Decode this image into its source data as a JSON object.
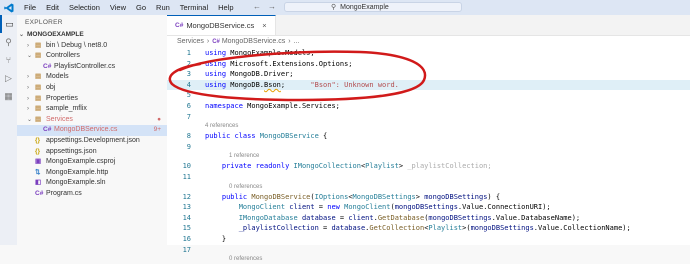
{
  "menubar": {
    "items": [
      "File",
      "Edit",
      "Selection",
      "View",
      "Go",
      "Run",
      "Terminal",
      "Help"
    ],
    "search_text": "MongoExample"
  },
  "sidebar": {
    "title": "EXPLORER",
    "project": "MONGOEXAMPLE",
    "rows": [
      {
        "label": "bin \\ Debug \\ net8.0",
        "indent": 1,
        "chevron": "›",
        "icon": "folder"
      },
      {
        "label": "Controllers",
        "indent": 1,
        "chevron": "⌄",
        "icon": "folder"
      },
      {
        "label": "PlaylistController.cs",
        "indent": 2,
        "chevron": "",
        "icon": "C#"
      },
      {
        "label": "Models",
        "indent": 1,
        "chevron": "›",
        "icon": "folder"
      },
      {
        "label": "obj",
        "indent": 1,
        "chevron": "›",
        "icon": "folder"
      },
      {
        "label": "Properties",
        "indent": 1,
        "chevron": "›",
        "icon": "folder"
      },
      {
        "label": "sample_mflix",
        "indent": 1,
        "chevron": "›",
        "icon": "folder"
      },
      {
        "label": "Services",
        "indent": 1,
        "chevron": "⌄",
        "icon": "folder",
        "badge": "●",
        "error": true
      },
      {
        "label": "MongoDBService.cs",
        "indent": 2,
        "chevron": "",
        "icon": "C#",
        "badge": "9+",
        "error": true,
        "selected": true
      },
      {
        "label": "appsettings.Development.json",
        "indent": 1,
        "chevron": "",
        "icon": "{}"
      },
      {
        "label": "appsettings.json",
        "indent": 1,
        "chevron": "",
        "icon": "{}"
      },
      {
        "label": "MongoExample.csproj",
        "indent": 1,
        "chevron": "",
        "icon": "proj"
      },
      {
        "label": "MongoExample.http",
        "indent": 1,
        "chevron": "",
        "icon": "http"
      },
      {
        "label": "MongoExample.sln",
        "indent": 1,
        "chevron": "",
        "icon": "sln"
      },
      {
        "label": "Program.cs",
        "indent": 1,
        "chevron": "",
        "icon": "C#"
      }
    ]
  },
  "editor": {
    "tab_label": "MongoDBService.cs",
    "tab_icon": "C#",
    "breadcrumb": [
      "Services",
      "MongoDBService.cs",
      "..."
    ],
    "hover_hint": "\"Bson\": Unknown word.",
    "lens": {
      "refs4": "4 references",
      "refs1": "1 reference",
      "refs0": "0 references"
    }
  },
  "colors": {
    "accent": "#005fb8",
    "annotation": "#d11a1a",
    "error": "#d16a6a"
  }
}
